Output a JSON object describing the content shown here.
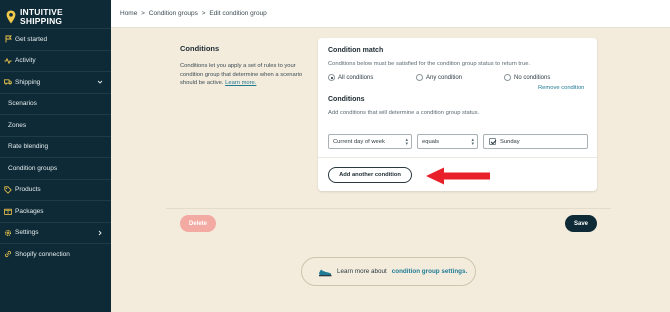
{
  "brand": {
    "line1": "INTUITIVE",
    "line2": "SHIPPING",
    "accent": "#f2c94c"
  },
  "sidebar": {
    "items": [
      {
        "label": "Get started",
        "icon": "flag-icon",
        "name": "sidebar-item-get-started"
      },
      {
        "label": "Activity",
        "icon": "activity-icon",
        "name": "sidebar-item-activity"
      },
      {
        "label": "Shipping",
        "icon": "truck-icon",
        "name": "sidebar-item-shipping",
        "expanded": true
      },
      {
        "label": "Scenarios",
        "name": "sidebar-item-scenarios",
        "sub": true
      },
      {
        "label": "Zones",
        "name": "sidebar-item-zones",
        "sub": true
      },
      {
        "label": "Rate blending",
        "name": "sidebar-item-rate-blending",
        "sub": true
      },
      {
        "label": "Condition groups",
        "name": "sidebar-item-condition-groups",
        "sub": true
      },
      {
        "label": "Products",
        "icon": "tag-icon",
        "name": "sidebar-item-products"
      },
      {
        "label": "Packages",
        "icon": "package-icon",
        "name": "sidebar-item-packages"
      },
      {
        "label": "Settings",
        "icon": "gear-icon",
        "name": "sidebar-item-settings"
      },
      {
        "label": "Shopify connection",
        "icon": "link-icon",
        "name": "sidebar-item-shopify-connection"
      }
    ]
  },
  "breadcrumb": {
    "home": "Home",
    "sep": ">",
    "groups": "Condition groups",
    "current": "Edit condition group"
  },
  "conditions_section": {
    "title": "Conditions",
    "description": "Conditions let you apply a set of rules to your condition group that determine when a scenario should be active.",
    "learn_more": "Learn more."
  },
  "card": {
    "match_title": "Condition match",
    "match_desc": "Conditions below must be satisfied for the condition group status to return true.",
    "options": [
      "All conditions",
      "Any condition",
      "No conditions"
    ],
    "selected_option": "All conditions",
    "conditions_title": "Conditions",
    "conditions_desc": "Add conditions that will determine a condition group status.",
    "remove_label": "Remove condition",
    "field_value": "Current day of week",
    "operator_value": "equals",
    "day_value": "Sunday",
    "add_label": "Add another condition"
  },
  "actions": {
    "delete_label": "Delete",
    "save_label": "Save"
  },
  "help": {
    "prefix": "Learn more about",
    "link": "condition group settings."
  },
  "colors": {
    "sidebar_bg": "#0e2a36",
    "page_bg": "#f3ecdd",
    "link": "#1f7a94",
    "arrow": "#e8202a",
    "delete": "#f2aaa2"
  }
}
